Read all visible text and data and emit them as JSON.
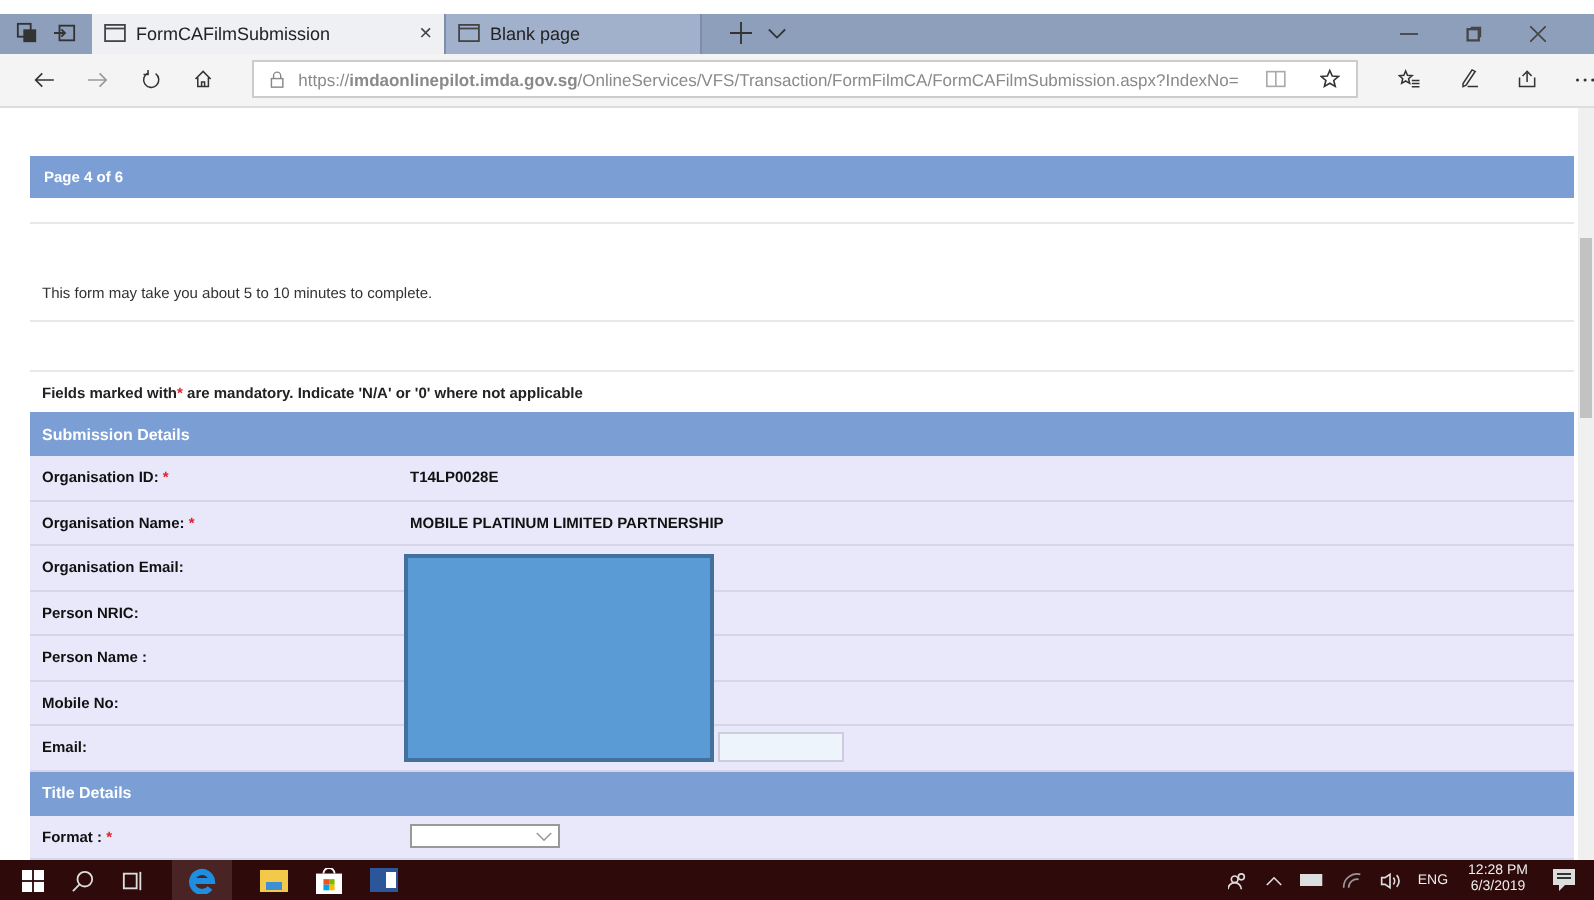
{
  "browser": {
    "tabs": [
      {
        "title": "FormCAFilmSubmission",
        "selected": true,
        "close": "×"
      },
      {
        "title": "Blank page",
        "selected": false
      }
    ],
    "address": "https://**imdaonlinepilot.imda.gov.sg**/OnlineServices/VFS/Transaction/FormFilmCA/FormCAFilmSubmission.aspx?IndexNo="
  },
  "page": {
    "pager": "Page 4 of 6",
    "intro": "This form may take you about 5 to 10 minutes to complete.",
    "mandatory_note": {
      "before": "Fields marked with",
      "mark": "*",
      "after": " are mandatory. Indicate 'N/A' or '0' where not applicable"
    },
    "sections": [
      {
        "title": "Submission Details",
        "rows": [
          {
            "label": "Organisation ID:",
            "required_mark": "*",
            "kind": "text",
            "value": "T14LP0028E"
          },
          {
            "label": "Organisation Name:",
            "required_mark": "*",
            "kind": "text",
            "value": "MOBILE PLATINUM LIMITED PARTNERSHIP"
          },
          {
            "label": "Organisation Email:",
            "kind": "text"
          },
          {
            "label": "Person NRIC:",
            "kind": "text"
          },
          {
            "label": "Person Name :",
            "kind": "text"
          },
          {
            "label": "Mobile No:",
            "kind": "text"
          },
          {
            "label": "Email:",
            "kind": "input"
          }
        ]
      },
      {
        "title": "Title Details",
        "rows": [
          {
            "label": "Format :",
            "required_mark": "*",
            "kind": "select"
          }
        ]
      }
    ]
  },
  "taskbar": {
    "language": "ENG",
    "time": "12:28 PM",
    "date": "6/3/2019"
  }
}
